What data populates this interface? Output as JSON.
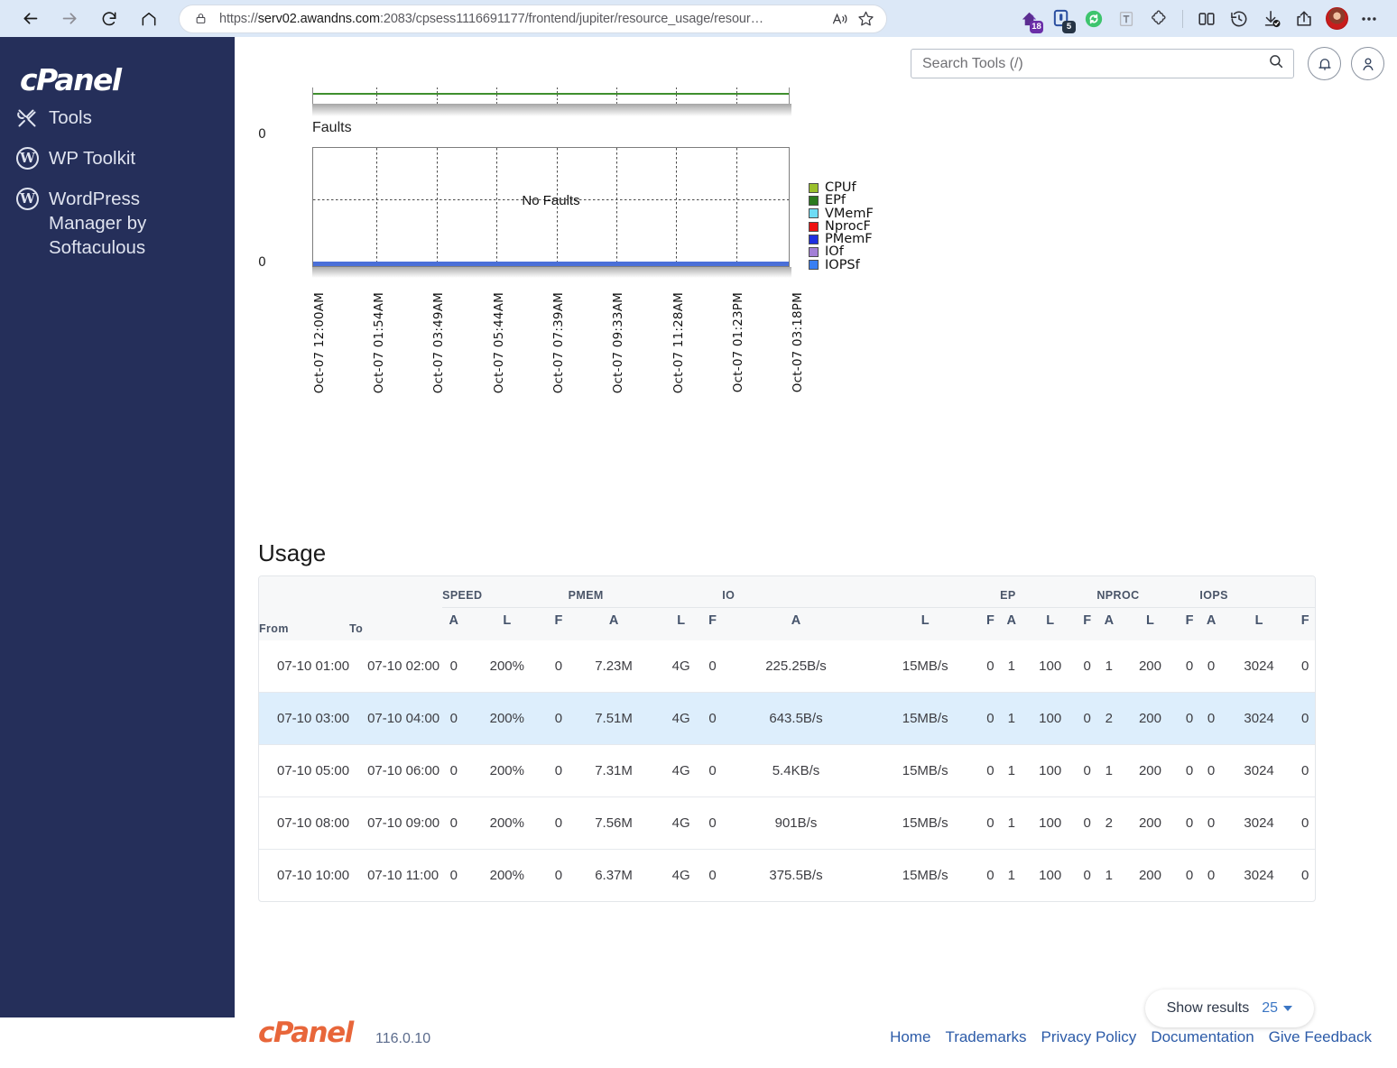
{
  "browser": {
    "url_prefix": "https://",
    "url_host": "serv02.awandns.com",
    "url_path": ":2083/cpsess1116691177/frontend/jupiter/resource_usage/resour…",
    "back_icon": "back-arrow-icon",
    "forward_icon": "forward-arrow-icon",
    "reload_icon": "reload-icon",
    "home_icon": "home-icon",
    "lock_icon": "lock-icon",
    "read_aloud_icon": "read-aloud-icon",
    "favorite_icon": "star-icon",
    "extensions": [
      {
        "name": "purple-extension-icon",
        "badge": "18"
      },
      {
        "name": "blue-notes-extension-icon",
        "badge": "5"
      },
      {
        "name": "green-refresh-extension-icon",
        "badge": ""
      },
      {
        "name": "text-extension-icon",
        "badge": ""
      },
      {
        "name": "puzzle-extensions-icon",
        "badge": ""
      },
      {
        "name": "split-screen-icon",
        "badge": ""
      },
      {
        "name": "history-icon",
        "badge": ""
      },
      {
        "name": "downloads-icon",
        "badge": ""
      },
      {
        "name": "share-icon",
        "badge": ""
      }
    ],
    "profile_icon": "profile-avatar",
    "settings_icon": "more-options-icon"
  },
  "sidebar": {
    "logo": "cPanel",
    "items": [
      {
        "label": "Tools",
        "icon": "tools-icon"
      },
      {
        "label": "WP Toolkit",
        "icon": "wordpress-icon"
      },
      {
        "label": "WordPress Manager by Softaculous",
        "icon": "wordpress-icon"
      }
    ]
  },
  "header": {
    "search_placeholder": "Search Tools (/)",
    "search_value": "",
    "search_icon": "search-icon",
    "notifications_icon": "bell-icon",
    "account_icon": "user-icon"
  },
  "chart": {
    "faults_label": "Faults",
    "no_faults_text": "No Faults",
    "y_zero_top": "0",
    "y_zero_bottom": "0",
    "legend": [
      {
        "label": "CPUf",
        "color": "#9ac02c"
      },
      {
        "label": "EPf",
        "color": "#2b7a1e"
      },
      {
        "label": "VMemF",
        "color": "#6edcf5"
      },
      {
        "label": "NprocF",
        "color": "#ee1111"
      },
      {
        "label": "PMemF",
        "color": "#1f2fe0"
      },
      {
        "label": "IOf",
        "color": "#a37fd6"
      },
      {
        "label": "IOPSf",
        "color": "#3a7ff2"
      }
    ],
    "x_labels": [
      "Oct-07 12:00AM",
      "Oct-07 01:54AM",
      "Oct-07 03:49AM",
      "Oct-07 05:44AM",
      "Oct-07 07:39AM",
      "Oct-07 09:33AM",
      "Oct-07 11:28AM",
      "Oct-07 01:23PM",
      "Oct-07 03:18PM"
    ]
  },
  "chart_data": {
    "type": "line",
    "title": "Faults",
    "xlabel": "",
    "ylabel": "",
    "annotation": "No Faults",
    "grid": true,
    "legend_position": "right",
    "x": [
      "Oct-07 12:00AM",
      "Oct-07 01:54AM",
      "Oct-07 03:49AM",
      "Oct-07 05:44AM",
      "Oct-07 07:39AM",
      "Oct-07 09:33AM",
      "Oct-07 11:28AM",
      "Oct-07 01:23PM",
      "Oct-07 03:18PM"
    ],
    "ylim": [
      0,
      0
    ],
    "ytick_labels": [
      "0"
    ],
    "series": [
      {
        "name": "CPUf",
        "color": "#9ac02c",
        "values": [
          0,
          0,
          0,
          0,
          0,
          0,
          0,
          0,
          0
        ]
      },
      {
        "name": "EPf",
        "color": "#2b7a1e",
        "values": [
          0,
          0,
          0,
          0,
          0,
          0,
          0,
          0,
          0
        ]
      },
      {
        "name": "VMemF",
        "color": "#6edcf5",
        "values": [
          0,
          0,
          0,
          0,
          0,
          0,
          0,
          0,
          0
        ]
      },
      {
        "name": "NprocF",
        "color": "#ee1111",
        "values": [
          0,
          0,
          0,
          0,
          0,
          0,
          0,
          0,
          0
        ]
      },
      {
        "name": "PMemF",
        "color": "#1f2fe0",
        "values": [
          0,
          0,
          0,
          0,
          0,
          0,
          0,
          0,
          0
        ]
      },
      {
        "name": "IOf",
        "color": "#a37fd6",
        "values": [
          0,
          0,
          0,
          0,
          0,
          0,
          0,
          0,
          0
        ]
      },
      {
        "name": "IOPSf",
        "color": "#3a7ff2",
        "values": [
          0,
          0,
          0,
          0,
          0,
          0,
          0,
          0,
          0
        ]
      }
    ]
  },
  "usage": {
    "title": "Usage",
    "col_from": "From",
    "col_to": "To",
    "groups": [
      "SPEED",
      "PMEM",
      "IO",
      "EP",
      "NPROC",
      "IOPS"
    ],
    "subheaders": [
      "A",
      "L",
      "F",
      "A",
      "L",
      "F",
      "A",
      "L",
      "F",
      "A",
      "L",
      "F",
      "A",
      "L",
      "F",
      "A",
      "L",
      "F"
    ],
    "rows": [
      {
        "from": "07-10 01:00",
        "to": "07-10 02:00",
        "cells": [
          "0",
          "200%",
          "0",
          "7.23M",
          "4G",
          "0",
          "225.25B/s",
          "15MB/s",
          "0",
          "1",
          "100",
          "0",
          "1",
          "200",
          "0",
          "0",
          "3024",
          "0"
        ]
      },
      {
        "from": "07-10 03:00",
        "to": "07-10 04:00",
        "cells": [
          "0",
          "200%",
          "0",
          "7.51M",
          "4G",
          "0",
          "643.5B/s",
          "15MB/s",
          "0",
          "1",
          "100",
          "0",
          "2",
          "200",
          "0",
          "0",
          "3024",
          "0"
        ]
      },
      {
        "from": "07-10 05:00",
        "to": "07-10 06:00",
        "cells": [
          "0",
          "200%",
          "0",
          "7.31M",
          "4G",
          "0",
          "5.4KB/s",
          "15MB/s",
          "0",
          "1",
          "100",
          "0",
          "1",
          "200",
          "0",
          "0",
          "3024",
          "0"
        ]
      },
      {
        "from": "07-10 08:00",
        "to": "07-10 09:00",
        "cells": [
          "0",
          "200%",
          "0",
          "7.56M",
          "4G",
          "0",
          "901B/s",
          "15MB/s",
          "0",
          "1",
          "100",
          "0",
          "2",
          "200",
          "0",
          "0",
          "3024",
          "0"
        ]
      },
      {
        "from": "07-10 10:00",
        "to": "07-10 11:00",
        "cells": [
          "0",
          "200%",
          "0",
          "6.37M",
          "4G",
          "0",
          "375.5B/s",
          "15MB/s",
          "0",
          "1",
          "100",
          "0",
          "1",
          "200",
          "0",
          "0",
          "3024",
          "0"
        ]
      }
    ]
  },
  "pagination": {
    "label": "Show results",
    "count": "25"
  },
  "footer": {
    "logo": "cPanel",
    "version": "116.0.10",
    "links": [
      "Home",
      "Trademarks",
      "Privacy Policy",
      "Documentation",
      "Give Feedback"
    ]
  }
}
